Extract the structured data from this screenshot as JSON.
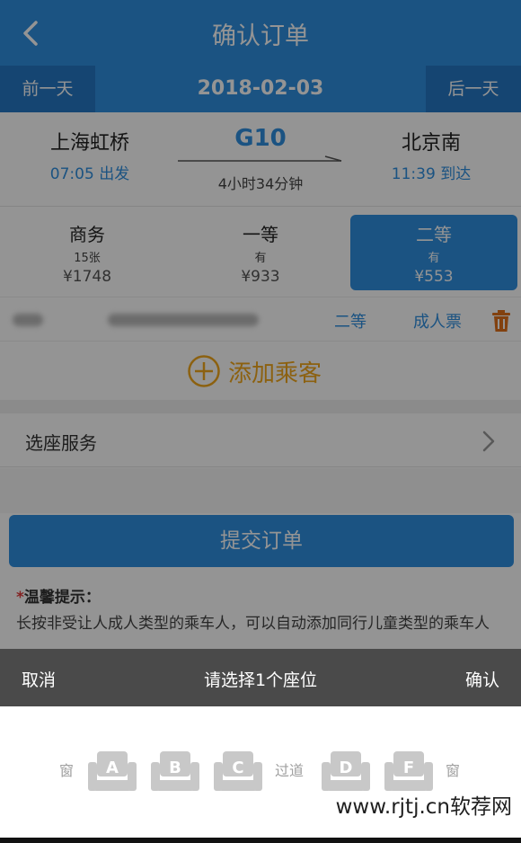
{
  "header": {
    "title": "确认订单"
  },
  "datebar": {
    "prev": "前一天",
    "date": "2018-02-03",
    "next": "后一天"
  },
  "train": {
    "from_station": "上海虹桥",
    "depart_time": "07:05 出发",
    "number": "G10",
    "duration": "4小时34分钟",
    "to_station": "北京南",
    "arrive_time": "11:39 到达"
  },
  "seat_classes": [
    {
      "name": "商务",
      "count": "15张",
      "price": "¥1748"
    },
    {
      "name": "一等",
      "count": "有",
      "price": "¥933"
    },
    {
      "name": "二等",
      "count": "有",
      "price": "¥553"
    }
  ],
  "passenger": {
    "seat": "二等",
    "type": "成人票"
  },
  "add_passenger": {
    "label": "添加乘客"
  },
  "seat_service": {
    "label": "选座服务"
  },
  "submit": {
    "label": "提交订单"
  },
  "tips": {
    "star": "*",
    "title": "温馨提示：",
    "text": "长按非受让人成人类型的乘车人，可以自动添加同行儿童类型的乘车人"
  },
  "sheet": {
    "cancel": "取消",
    "title": "请选择1个座位",
    "confirm": "确认"
  },
  "seat_map": {
    "window_left": "窗",
    "aisle": "过道",
    "window_right": "窗",
    "seats": [
      "A",
      "B",
      "C",
      "D",
      "F"
    ]
  },
  "watermark": "www.rjtj.cn软荐网",
  "colors": {
    "primary": "#2f8fe0",
    "accent": "#f2a81d",
    "sheet_bar": "#4a4a4a",
    "seat_gray": "#c8c8c8"
  }
}
